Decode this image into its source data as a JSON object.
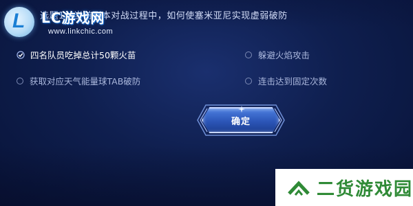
{
  "question": {
    "text": "选题1：当前副本对战过程中，如何使塞米亚尼实现虚弱破防"
  },
  "logo": {
    "letter": "L",
    "title": "LC游戏网",
    "url": "www.linkchic.com"
  },
  "options": [
    {
      "label": "四名队员吃掉总计50颗火苗",
      "selected": true
    },
    {
      "label": "躲避火焰攻击",
      "selected": false
    },
    {
      "label": "获取对应天气能量球TAB破防",
      "selected": false
    },
    {
      "label": "连击达到固定次数",
      "selected": false
    }
  ],
  "confirm_button": {
    "label": "确定"
  },
  "watermark": {
    "text": "二货游戏园",
    "icon": "up-chevron-icon"
  },
  "colors": {
    "background": "#0f1f4f",
    "button": "#2c56b8",
    "watermark_green": "#2f8a36",
    "selected_text": "#ffffff",
    "unselected_text": "#aab7dc"
  }
}
